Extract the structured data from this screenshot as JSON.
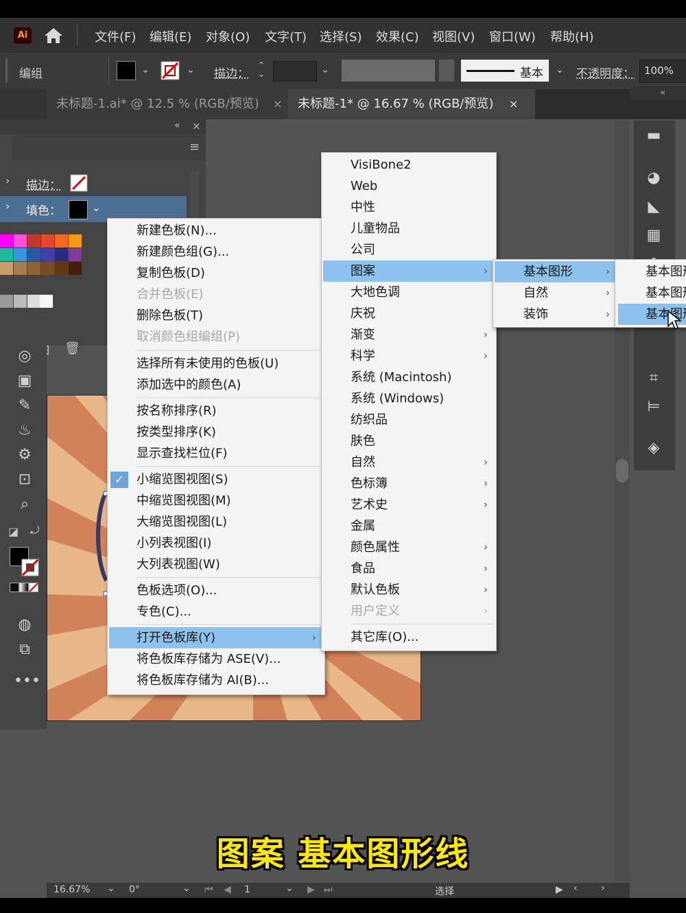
{
  "app": {
    "logo": "Ai",
    "menus": [
      "文件(F)",
      "编辑(E)",
      "对象(O)",
      "文字(T)",
      "选择(S)",
      "效果(C)",
      "视图(V)",
      "窗口(W)",
      "帮助(H)"
    ]
  },
  "control_bar": {
    "selection_type": "编组",
    "stroke_label": "描边：",
    "stroke_style": "基本",
    "opacity_label": "不透明度：",
    "opacity_value": "100%"
  },
  "tabs": [
    {
      "label": "未标题-1.ai* @ 12.5 % (RGB/预览)",
      "close": "×"
    },
    {
      "label": "未标题-1* @ 16.67 % (RGB/预览)",
      "close": "×"
    }
  ],
  "swatches_panel": {
    "stroke_label": "描边：",
    "fill_label": "填色：",
    "collapse": "«",
    "close": "×"
  },
  "context_menu": {
    "items": [
      "新建色板(N)...",
      "新建颜色组(G)...",
      "复制色板(D)",
      "合并色板(E)",
      "删除色板(T)",
      "取消颜色组编组(P)",
      "选择所有未使用的色板(U)",
      "添加选中的颜色(A)",
      "按名称排序(R)",
      "按类型排序(K)",
      "显示查找栏位(F)",
      "小缩览图视图(S)",
      "中缩览图视图(M)",
      "大缩览图视图(L)",
      "小列表视图(I)",
      "大列表视图(W)",
      "色板选项(O)...",
      "专色(C)...",
      "打开色板库(Y)",
      "将色板库存储为 ASE(V)...",
      "将色板库存储为 AI(B)..."
    ],
    "checkmark": "✓",
    "submenu_arrow": "›"
  },
  "library_menu": {
    "items": [
      "VisiBone2",
      "Web",
      "中性",
      "儿童物品",
      "公司",
      "图案",
      "大地色调",
      "庆祝",
      "渐变",
      "科学",
      "系统 (Macintosh)",
      "系统 (Windows)",
      "纺织品",
      "肤色",
      "自然",
      "色标簿",
      "艺术史",
      "金属",
      "颜色属性",
      "食品",
      "默认色板",
      "用户定义",
      "其它库(O)..."
    ]
  },
  "pattern_menu": {
    "items": [
      "基本图形",
      "自然",
      "装饰"
    ]
  },
  "basic_shapes_menu": {
    "items": [
      "基本图形",
      "基本图形",
      "基本图形"
    ]
  },
  "status_bar": {
    "zoom": "16.67%",
    "rotation": "0°",
    "artboard": "1",
    "tool": "选择"
  },
  "caption": "图案 基本图形线"
}
